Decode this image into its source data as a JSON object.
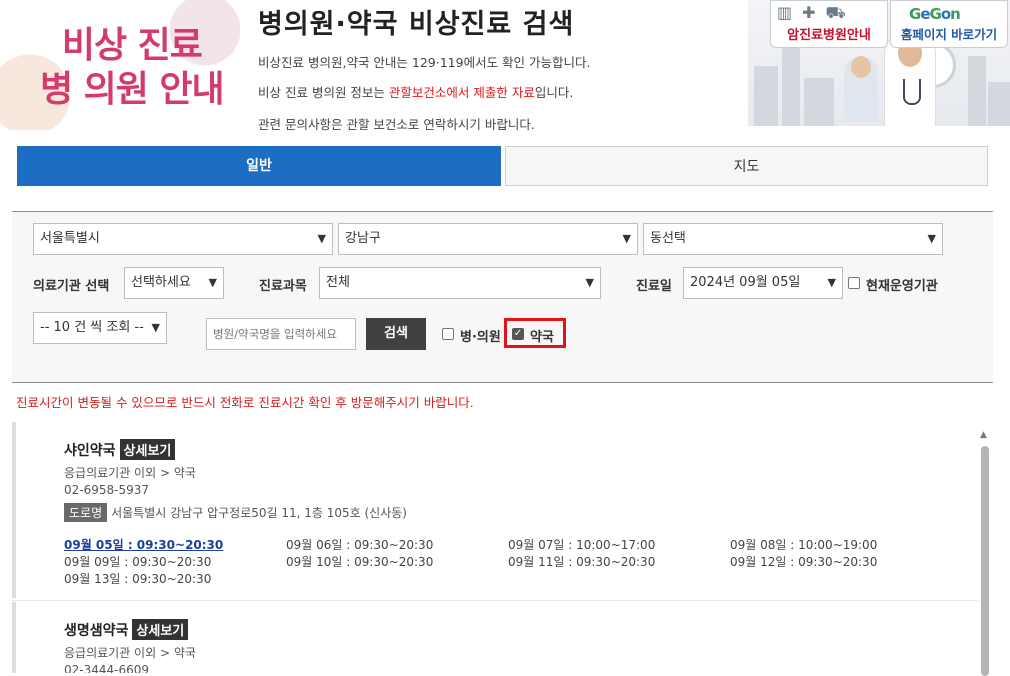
{
  "header": {
    "logo_line1": "비상 진료",
    "logo_line2": "병 의원 안내",
    "title": "병의원·약국 비상진료 검색",
    "line1": "비상진료 병의원,약국 안내는 129·119에서도 확인 가능합니다.",
    "line2_pre": "비상 진료 병의원 정보는 ",
    "line2_red": "관할보건소에서 제출한 자료",
    "line2_post": "입니다.",
    "line3": "관련 문의사항은 관할 보건소로 연락하시기 바랍니다.",
    "banner_btn1": "암진료병원안내",
    "banner_btn2": "홈페이지 바로가기"
  },
  "tabs": [
    {
      "label": "일반",
      "active": true
    },
    {
      "label": "지도",
      "active": false
    }
  ],
  "search": {
    "city": "서울특별시",
    "district": "강남구",
    "dong": "동선택",
    "inst_label": "의료기관 선택",
    "inst_value": "선택하세요",
    "dept_label": "진료과목",
    "dept_value": "전체",
    "date_label": "진료일",
    "date_value": "2024년 09월 05일",
    "current_label": "현재운영기관",
    "page_size": "-- 10 건 씩 조회 --",
    "name_placeholder": "병원/약국명을 입력하세요",
    "search_btn": "검색",
    "hospital_label": "병·의원",
    "hospital_checked": false,
    "pharmacy_label": "약국",
    "pharmacy_checked": true
  },
  "notice": "진료시간이 변동될 수 있으므로 반드시 전화로 진료시간 확인 후 방문해주시기 바랍니다.",
  "results": [
    {
      "name": "샤인약국",
      "detail_btn": "상세보기",
      "category": "응급의료기관 이외 > 약국",
      "phone": "02-6958-5937",
      "road_badge": "도로명",
      "address": "서울특별시 강남구 압구정로50길 11, 1층 105호 (신사동)",
      "hours": [
        "09월 05일 : 09:30~20:30",
        "09월 06일 : 09:30~20:30",
        "09월 07일 : 10:00~17:00",
        "09월 08일 : 10:00~19:00",
        "09월 09일 : 09:30~20:30",
        "09월 10일 : 09:30~20:30",
        "09월 11일 : 09:30~20:30",
        "09월 12일 : 09:30~20:30",
        "09월 13일 : 09:30~20:30"
      ]
    },
    {
      "name": "생명샘약국",
      "detail_btn": "상세보기",
      "category": "응급의료기관 이외 > 약국",
      "phone": "02-3444-6609"
    }
  ]
}
